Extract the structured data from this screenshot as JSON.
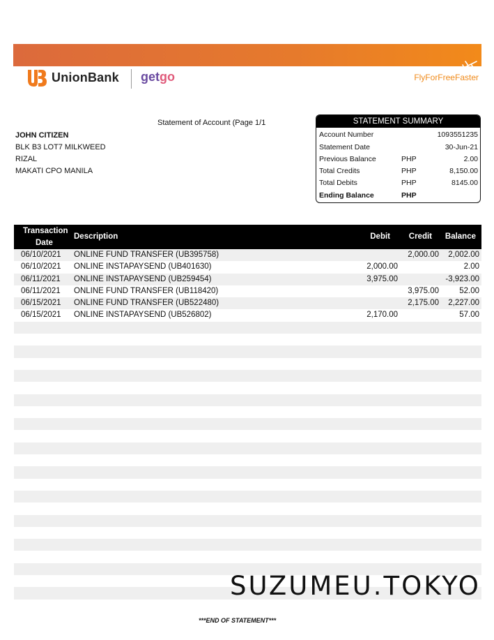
{
  "brand": {
    "bank_name": "UnionBank",
    "partner_name_part1": "get",
    "partner_name_part2": "go",
    "tagline": "FlyForFreeFaster",
    "banner_color": "#e67a2c",
    "accent_color": "#f08a1a"
  },
  "statement": {
    "title": "Statement of Account (Page 1/1"
  },
  "customer": {
    "name": "JOHN CITIZEN",
    "address_line1": "BLK B3 LOT7 MILKWEED",
    "address_line2": "RIZAL",
    "address_line3": "MAKATI CPO MANILA"
  },
  "summary": {
    "heading": "STATEMENT SUMMARY",
    "rows": [
      {
        "label": "Account Number",
        "currency": "",
        "value": "1093551235"
      },
      {
        "label": "Statement Date",
        "currency": "",
        "value": "30-Jun-21"
      },
      {
        "label": "Previous Balance",
        "currency": "PHP",
        "value": "2.00"
      },
      {
        "label": "Total Credits",
        "currency": "PHP",
        "value": "8,150.00"
      },
      {
        "label": "Total Debits",
        "currency": "PHP",
        "value": "8145.00"
      },
      {
        "label": "Ending Balance",
        "currency": "PHP",
        "value": ""
      }
    ]
  },
  "table": {
    "headers": {
      "date_line1": "Transaction",
      "date_line2": "Date",
      "description": "Description",
      "debit": "Debit",
      "credit": "Credit",
      "balance": "Balance"
    },
    "rows": [
      {
        "date": "06/10/2021",
        "description": "ONLINE FUND TRANSFER (UB395758)",
        "debit": "",
        "credit": "2,000.00",
        "balance": "2,002.00"
      },
      {
        "date": "06/10/2021",
        "description": "ONLINE INSTAPAYSEND (UB401630)",
        "debit": "2,000.00",
        "credit": "",
        "balance": "2.00"
      },
      {
        "date": "06/11/2021",
        "description": "ONLINE INSTAPAYSEND (UB259454)",
        "debit": "3,975.00",
        "credit": "",
        "balance": "-3,923.00"
      },
      {
        "date": "06/11/2021",
        "description": "ONLINE FUND TRANSFER (UB118420)",
        "debit": "",
        "credit": "3,975.00",
        "balance": "52.00"
      },
      {
        "date": "06/15/2021",
        "description": "ONLINE FUND TRANSFER (UB522480)",
        "debit": "",
        "credit": "2,175.00",
        "balance": "2,227.00"
      },
      {
        "date": "06/15/2021",
        "description": "ONLINE INSTAPAYSEND (UB526802)",
        "debit": "2,170.00",
        "credit": "",
        "balance": "57.00"
      }
    ],
    "empty_row_count": 23
  },
  "watermark": "SUZUMEU.TOKYO",
  "footer": "***END OF STATEMENT***"
}
